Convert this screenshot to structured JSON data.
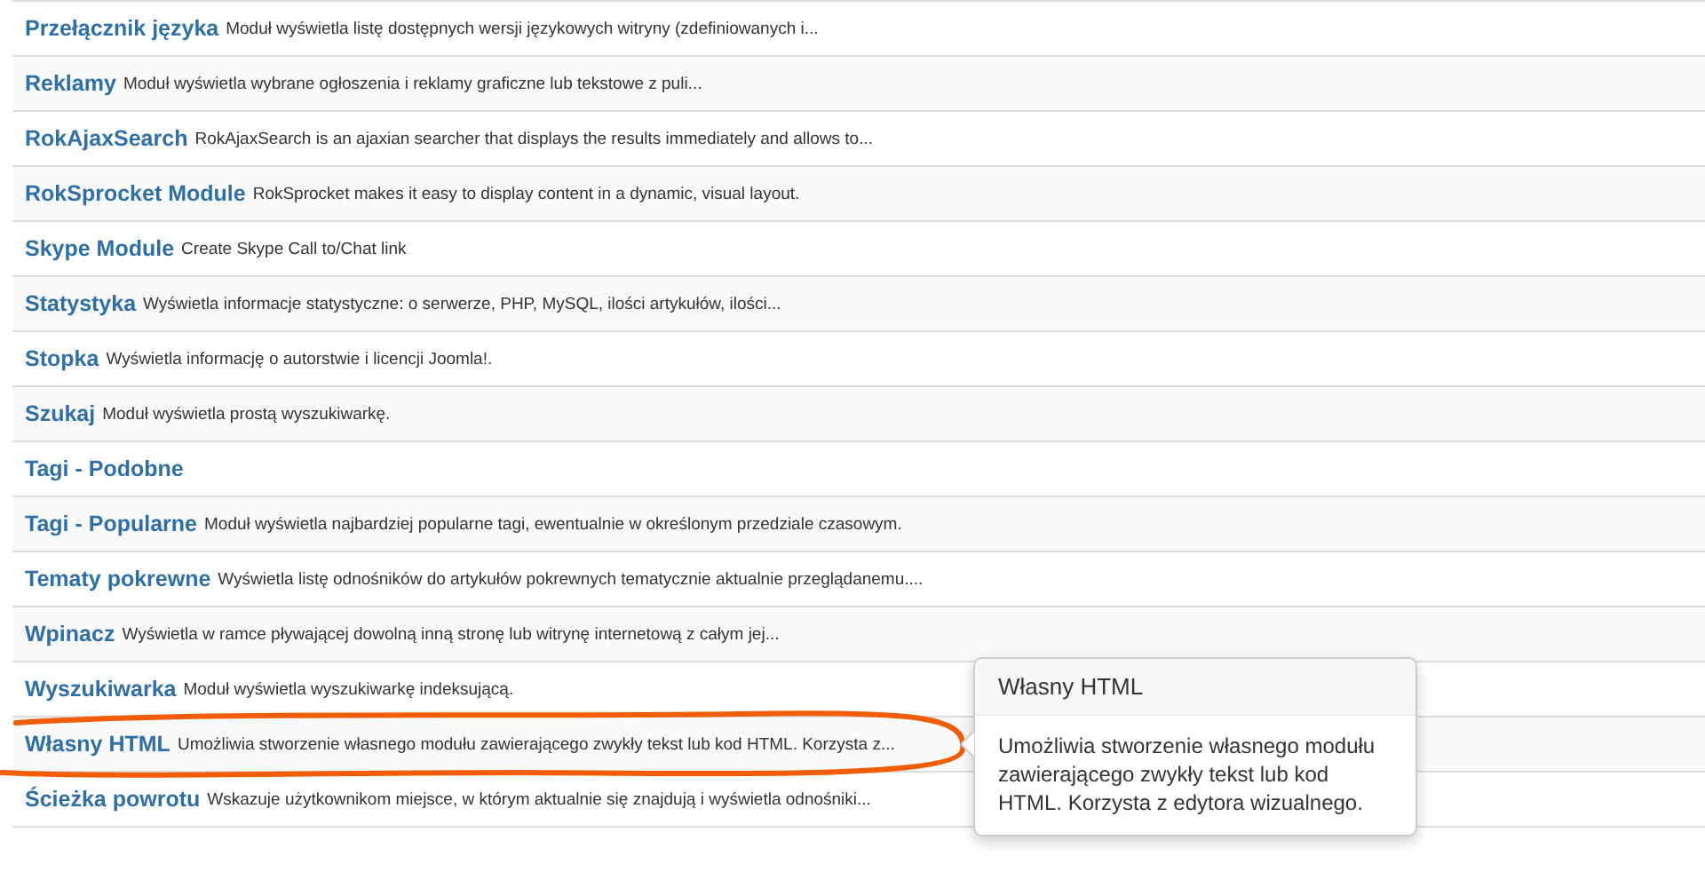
{
  "modules": [
    {
      "title": "Przełącznik języka",
      "description": "Moduł wyświetla listę dostępnych wersji językowych witryny (zdefiniowanych i...",
      "circled": false
    },
    {
      "title": "Reklamy",
      "description": "Moduł wyświetla wybrane ogłoszenia i reklamy graficzne lub tekstowe z puli...",
      "circled": false
    },
    {
      "title": "RokAjaxSearch",
      "description": "RokAjaxSearch is an ajaxian searcher that displays the results immediately and allows to...",
      "circled": false
    },
    {
      "title": "RokSprocket Module",
      "description": "RokSprocket makes it easy to display content in a dynamic, visual layout.",
      "circled": false
    },
    {
      "title": "Skype Module",
      "description": "Create Skype Call to/Chat link",
      "circled": false
    },
    {
      "title": "Statystyka",
      "description": "Wyświetla informacje statystyczne: o serwerze, PHP, MySQL, ilości artykułów, ilości...",
      "circled": false
    },
    {
      "title": "Stopka",
      "description": "Wyświetla informację o autorstwie i licencji Joomla!.",
      "circled": false
    },
    {
      "title": "Szukaj",
      "description": "Moduł wyświetla prostą wyszukiwarkę.",
      "circled": false
    },
    {
      "title": "Tagi - Podobne",
      "circled": false
    },
    {
      "title": "Tagi - Popularne",
      "description": "Moduł wyświetla najbardziej popularne tagi, ewentualnie w określonym przedziale czasowym.",
      "circled": false
    },
    {
      "title": "Tematy pokrewne",
      "description": "Wyświetla listę odnośników do artykułów pokrewnych tematycznie aktualnie przeglądanemu....",
      "circled": false
    },
    {
      "title": "Wpinacz",
      "description": "Wyświetla w ramce pływającej dowolną inną stronę lub witrynę internetową z całym jej...",
      "circled": false
    },
    {
      "title": "Wyszukiwarka",
      "description": "Moduł wyświetla wyszukiwarkę indeksującą.",
      "circled": false
    },
    {
      "title": "Własny HTML",
      "description": "Umożliwia stworzenie własnego modułu zawierającego zwykły tekst lub kod HTML. Korzysta z...",
      "circled": true,
      "popover": {
        "title": "Własny HTML",
        "body": "Umożliwia stworzenie własnego modułu zawierającego zwykły tekst lub kod HTML. Korzysta z edytora wizualnego."
      }
    },
    {
      "title": "Ścieżka powrotu",
      "description": "Wskazuje użytkownikom miejsce, w którym aktualnie się znajdują i wyświetla odnośniki...",
      "circled": false
    }
  ]
}
